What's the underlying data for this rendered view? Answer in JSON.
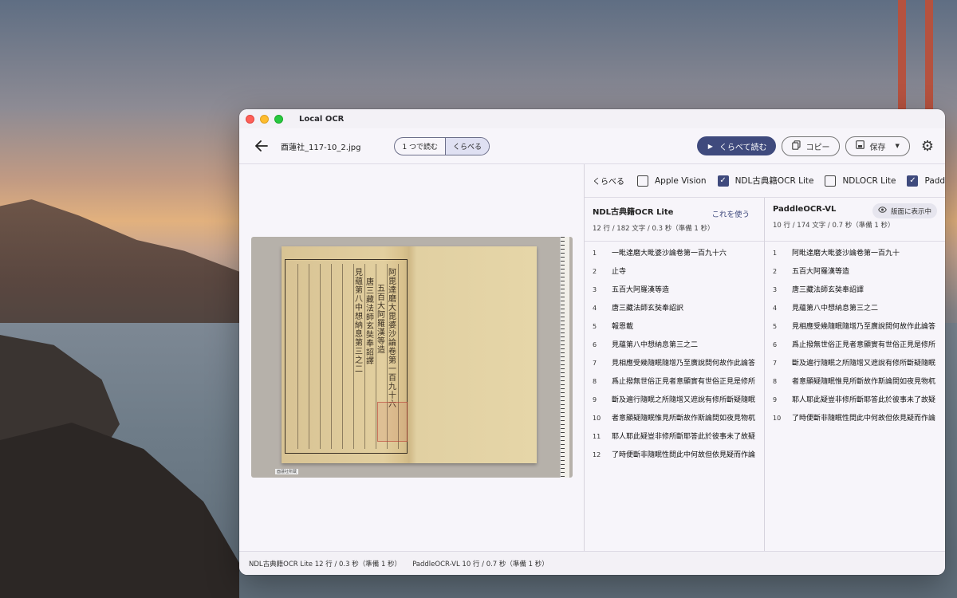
{
  "window": {
    "title": "Local OCR",
    "filename": "酉蓮社_117-10_2.jpg"
  },
  "toolbar": {
    "mode_single": "1 つで読む",
    "mode_compare": "くらべる",
    "compare_read_label": "くらべて読む",
    "copy_label": "コピー",
    "save_label": "保存",
    "accent_color": "#3f4a7d"
  },
  "scan": {
    "caption": "酉蓮社所蔵",
    "text_sample": [
      "阿毘達磨大毘婆沙論卷第一百九十六",
      "五百大阿羅漢等造",
      "唐三藏法師玄奘奉詔譯",
      "見蘊第八中想納息第三之二"
    ]
  },
  "engines": {
    "label": "くらべる",
    "items": [
      {
        "name": "Apple Vision",
        "checked": false
      },
      {
        "name": "NDL古典籍OCR Lite",
        "checked": true
      },
      {
        "name": "NDLOCR Lite",
        "checked": false
      },
      {
        "name": "PaddleOCR-VL",
        "checked": true
      }
    ]
  },
  "results": [
    {
      "engine": "NDL古典籍OCR Lite",
      "stats": "12 行 / 182 文字 / 0.3 秒（準備 1 秒）",
      "action": "これを使う",
      "lines": [
        {
          "n": "1",
          "t": "一毗達磨大毗婆沙論卷第一百九十六"
        },
        {
          "n": "2",
          "t": "止寺"
        },
        {
          "n": "3",
          "t": "五百大阿羅漢等造"
        },
        {
          "n": "4",
          "t": "唐三藏法師玄奘奉詔訳"
        },
        {
          "n": "5",
          "t": "報恩載"
        },
        {
          "n": "6",
          "t": "見蘊第八中想納息第三之二"
        },
        {
          "n": "7",
          "t": "見相應受幾隨眠隨增乃至廣說問何故作此論答"
        },
        {
          "n": "8",
          "t": "爲止撥無世俗正見者意顯實有世俗正見是修所"
        },
        {
          "n": "9",
          "t": "斷及遍行隨眠之所隨增又遮說有修所斷疑隨眠"
        },
        {
          "n": "10",
          "t": "者意顯疑隨眠惟見所斷故作斯論問如夜見物杌"
        },
        {
          "n": "11",
          "t": "耶人耶此疑豈非修所斷耶答此於彼事未了故疑"
        },
        {
          "n": "12",
          "t": "了時便斷非隨眠性問此中何故但依見疑而作論"
        }
      ]
    },
    {
      "engine": "PaddleOCR-VL",
      "stats": "10 行 / 174 文字 / 0.7 秒（準備 1 秒）",
      "action": "版面に表示中",
      "lines": [
        {
          "n": "1",
          "t": "阿毗達磨大毗婆沙論卷第一百九十"
        },
        {
          "n": "2",
          "t": "五百大阿羅漢等造"
        },
        {
          "n": "3",
          "t": "唐三藏法師玄奘奉詔譯"
        },
        {
          "n": "4",
          "t": "見蘊第八中想納息第三之二"
        },
        {
          "n": "5",
          "t": "見相應受幾隨眠隨增乃至廣說問何故作此論答"
        },
        {
          "n": "6",
          "t": "爲止撥無世俗正見者意顯實有世俗正見是修所"
        },
        {
          "n": "7",
          "t": "斷及遍行隨眠之所隨增又遮說有修所斷疑隨眠"
        },
        {
          "n": "8",
          "t": "者意顯疑隨眠惟見所斷故作斯論問如夜見物杌"
        },
        {
          "n": "9",
          "t": "耶人耶此疑豈非修所斷耶答此於彼事未了故疑"
        },
        {
          "n": "10",
          "t": "了時便斷非隨眠性問此中何故但依見疑而作論"
        }
      ]
    }
  ],
  "status": {
    "left": "NDL古典籍OCR Lite 12 行 / 0.3 秒（準備 1 秒）",
    "right": "PaddleOCR-VL 10 行 / 0.7 秒（準備 1 秒）"
  }
}
